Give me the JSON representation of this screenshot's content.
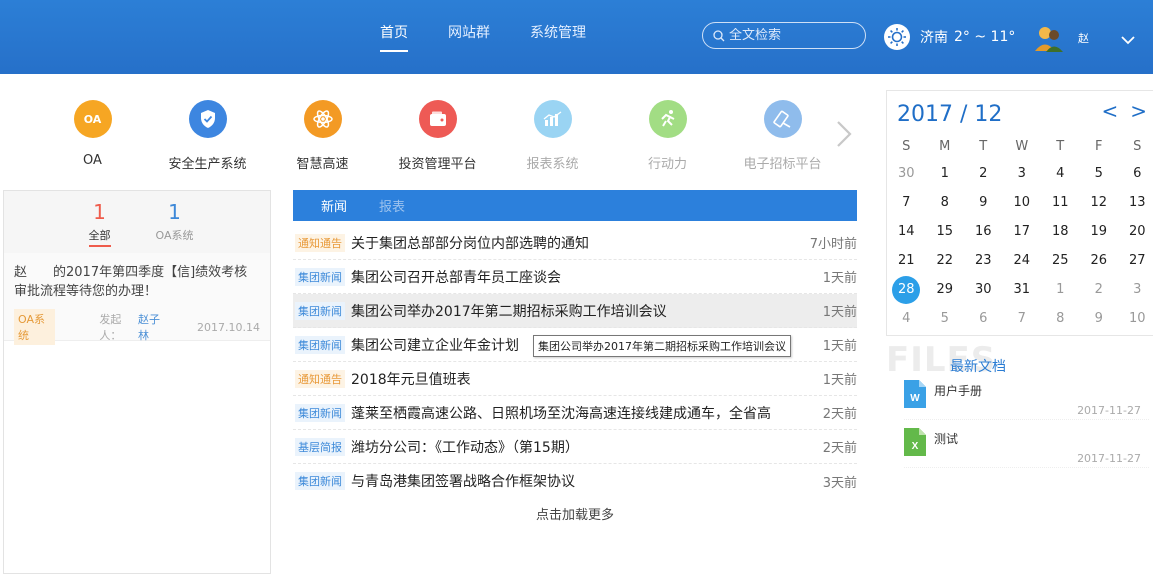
{
  "header": {
    "nav": [
      "首页",
      "网站群",
      "系统管理"
    ],
    "search_placeholder": "全文检索",
    "weather": {
      "city": "济南",
      "temp": "2° ~ 11°"
    },
    "user_name": "赵"
  },
  "apps": [
    {
      "label": "OA",
      "icon_text": "OA",
      "color": "#f6a623",
      "icon": "oa-icon"
    },
    {
      "label": "安全生产系统",
      "icon_text": "",
      "color": "#3d86e0",
      "icon": "shield-icon"
    },
    {
      "label": "智慧高速",
      "icon_text": "",
      "color": "#f39a24",
      "icon": "atom-icon"
    },
    {
      "label": "投资管理平台",
      "icon_text": "",
      "color": "#ee5a55",
      "icon": "wallet-icon"
    },
    {
      "label": "报表系统",
      "icon_text": "",
      "color": "#9ad4f3",
      "icon": "chart-icon"
    },
    {
      "label": "行动力",
      "icon_text": "",
      "color": "#a2dd84",
      "icon": "runner-icon"
    },
    {
      "label": "电子招标平台",
      "icon_text": "",
      "color": "#8fbcec",
      "icon": "pen-icon"
    }
  ],
  "left_panel": {
    "tabs": [
      {
        "count": "1",
        "label": "全部"
      },
      {
        "count": "1",
        "label": "OA系统"
      }
    ],
    "task": {
      "title": "赵　　的2017年第四季度【信]绩效考核审批流程等待您的办理！",
      "tag": "OA系统",
      "by_label": "发起人：",
      "by_name": "赵子林",
      "date": "2017.10.14"
    }
  },
  "news": {
    "tabs": [
      "新闻",
      "报表"
    ],
    "items": [
      {
        "cat": "通知通告",
        "title": "关于集团总部部分岗位内部选聘的通知",
        "time": "7小时前"
      },
      {
        "cat": "集团新闻",
        "title": "集团公司召开总部青年员工座谈会",
        "time": "1天前"
      },
      {
        "cat": "集团新闻",
        "title": "集团公司举办2017年第二期招标采购工作培训会议",
        "time": "1天前"
      },
      {
        "cat": "集团新闻",
        "title": "集团公司建立企业年金计划",
        "time": "1天前"
      },
      {
        "cat": "通知通告",
        "title": "2018年元旦值班表",
        "time": "1天前"
      },
      {
        "cat": "集团新闻",
        "title": "蓬莱至栖霞高速公路、日照机场至沈海高速连接线建成通车，全省高...",
        "time": "2天前"
      },
      {
        "cat": "基层简报",
        "title": "潍坊分公司：《工作动态》（第15期）",
        "time": "2天前"
      },
      {
        "cat": "集团新闻",
        "title": "与青岛港集团签署战略合作框架协议",
        "time": "3天前"
      }
    ],
    "tooltip": "集团公司举办2017年第二期招标采购工作培训会议",
    "more": "点击加载更多"
  },
  "calendar": {
    "title": "2017 / 12",
    "weekdays": [
      "S",
      "M",
      "T",
      "W",
      "T",
      "F",
      "S"
    ],
    "days": [
      "30",
      "1",
      "2",
      "3",
      "4",
      "5",
      "6",
      "7",
      "8",
      "9",
      "10",
      "11",
      "12",
      "13",
      "14",
      "15",
      "16",
      "17",
      "18",
      "19",
      "20",
      "21",
      "22",
      "23",
      "24",
      "25",
      "26",
      "27",
      "28",
      "29",
      "30",
      "31",
      "1",
      "2",
      "3",
      "4",
      "5",
      "6",
      "7",
      "8",
      "9",
      "10"
    ],
    "today": "28"
  },
  "files": {
    "bg_text": "FILES",
    "title": "最新文档",
    "items": [
      {
        "name": "用户手册",
        "date": "2017-11-27",
        "type": "word"
      },
      {
        "name": "测试",
        "date": "2017-11-27",
        "type": "excel"
      }
    ]
  }
}
